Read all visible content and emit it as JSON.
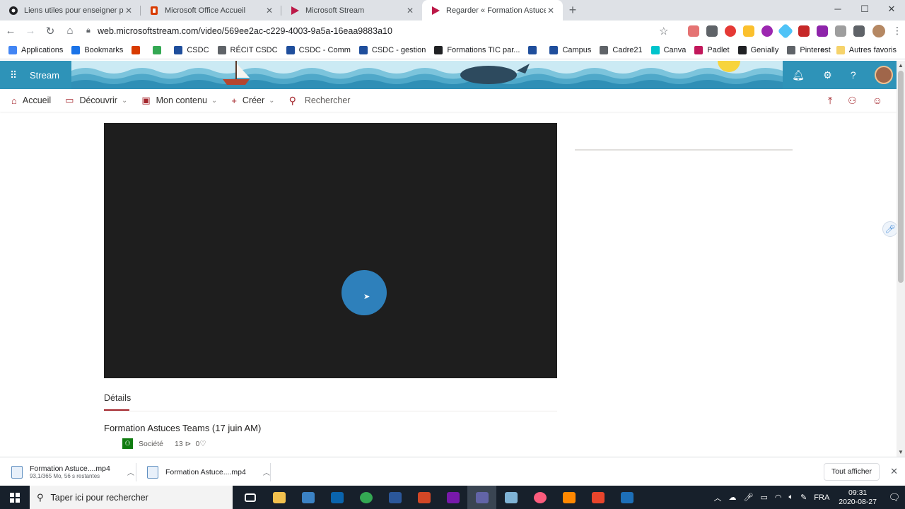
{
  "browser": {
    "tabs": [
      {
        "title": "Liens utiles pour enseigner par c",
        "favicon": "chrome-icon",
        "color": "#202124"
      },
      {
        "title": "Microsoft Office Accueil",
        "favicon": "office-icon",
        "color": "#d83b01"
      },
      {
        "title": "Microsoft Stream",
        "favicon": "stream-icon",
        "color": "#bc1948"
      },
      {
        "title": "Regarder « Formation Astuces Te",
        "favicon": "stream-icon",
        "color": "#bc1948"
      }
    ],
    "active_tab_index": 3,
    "url": "web.microsoftstream.com/video/569ee2ac-c229-4003-9a5a-16eaa9883a10",
    "bookmarks": [
      {
        "label": "Applications",
        "color": "#4285f4"
      },
      {
        "label": "Bookmarks",
        "color": "#1a73e8"
      },
      {
        "label": "",
        "color": "#d83b01"
      },
      {
        "label": "",
        "color": "#34a853"
      },
      {
        "label": "CSDC",
        "color": "#1f4e9c"
      },
      {
        "label": "RÉCIT CSDC",
        "color": "#5f6368"
      },
      {
        "label": "CSDC - Comm",
        "color": "#1f4e9c"
      },
      {
        "label": "CSDC - gestion",
        "color": "#1f4e9c"
      },
      {
        "label": "Formations TIC par...",
        "color": "#202124"
      },
      {
        "label": "",
        "color": "#1f4e9c"
      },
      {
        "label": "Campus",
        "color": "#1f4e9c"
      },
      {
        "label": "Cadre21",
        "color": "#5f6368"
      },
      {
        "label": "Canva",
        "color": "#00c4cc"
      },
      {
        "label": "Padlet",
        "color": "#c2185b"
      },
      {
        "label": "Genially",
        "color": "#202124"
      },
      {
        "label": "Pinterest",
        "color": "#5f6368"
      }
    ],
    "other_bookmarks": "Autres favoris",
    "overflow": "»"
  },
  "stream": {
    "brand": "Stream",
    "accent": "#a4262c",
    "header_color": "#2e93b8",
    "nav": {
      "home": "Accueil",
      "discover": "Découvrir",
      "my_content": "Mon contenu",
      "create": "Créer",
      "search_placeholder": "Rechercher"
    },
    "details_tab": "Détails",
    "video": {
      "title": "Formation Astuces Teams (17 juin AM)",
      "visibility": "Société",
      "views": "13",
      "likes": "0"
    }
  },
  "downloads": [
    {
      "name": "Formation Astuce....mp4",
      "status": "93,1/365 Mo, 56 s restantes"
    },
    {
      "name": "Formation Astuce....mp4",
      "status": ""
    }
  ],
  "show_all": "Tout afficher",
  "taskbar": {
    "search_placeholder": "Taper ici pour rechercher",
    "apps": [
      {
        "name": "task-view",
        "color": "#ffffff"
      },
      {
        "name": "file-explorer",
        "color": "#f2c14e"
      },
      {
        "name": "calculator",
        "color": "#3b82c4"
      },
      {
        "name": "outlook",
        "color": "#0a64ad"
      },
      {
        "name": "chrome",
        "color": "#34a853"
      },
      {
        "name": "word",
        "color": "#2b579a"
      },
      {
        "name": "powerpoint",
        "color": "#d24726"
      },
      {
        "name": "onenote",
        "color": "#7719aa"
      },
      {
        "name": "teams",
        "color": "#6264a7"
      },
      {
        "name": "snipping",
        "color": "#7fb3d5"
      },
      {
        "name": "itunes",
        "color": "#fc5c7d"
      },
      {
        "name": "vlc",
        "color": "#ff8800"
      },
      {
        "name": "camtasia",
        "color": "#e8452c"
      },
      {
        "name": "whiteboard",
        "color": "#1d6fb8"
      }
    ],
    "language": "FRA",
    "time": "09:31",
    "date": "2020-08-27"
  }
}
